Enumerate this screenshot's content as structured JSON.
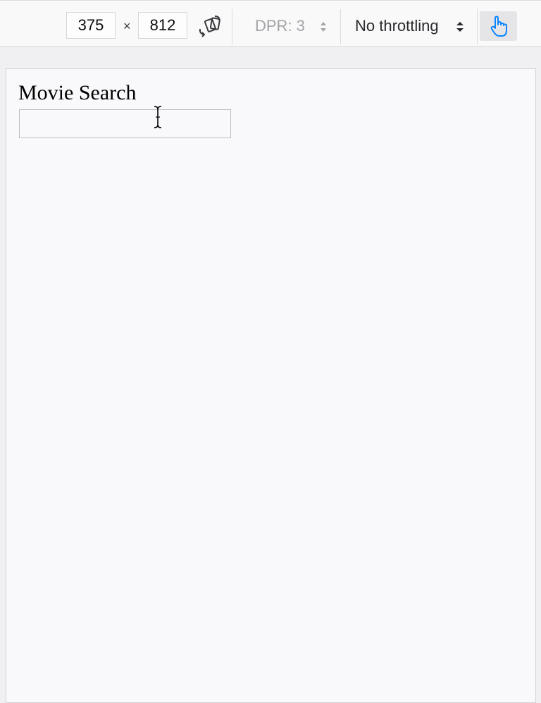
{
  "toolbar": {
    "viewport_width": "375",
    "viewport_height": "812",
    "times_symbol": "×",
    "dpr_label": "DPR: 3",
    "throttling_label": "No throttling",
    "icons": {
      "rotate": "rotate-device-icon",
      "dpr_arrows": "up-down-arrows-icon",
      "throttle_arrows": "up-down-arrows-icon",
      "touch": "touch-simulation-icon"
    },
    "colors": {
      "touch_icon": "#0a84ff"
    }
  },
  "page": {
    "title": "Movie Search",
    "search_value": "",
    "search_placeholder": ""
  }
}
